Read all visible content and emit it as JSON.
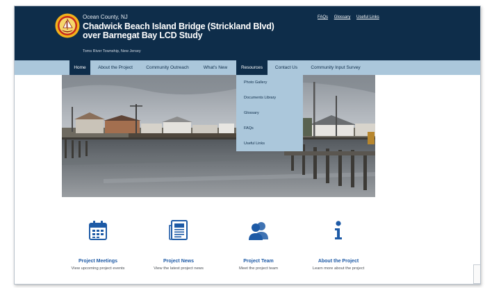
{
  "header": {
    "county": "Ocean County, NJ",
    "title": "Chadwick Beach Island Bridge (Strickland Blvd) over Barnegat Bay LCD Study",
    "subtitle": "Toms River Township, New Jersey",
    "utility_links": [
      "FAQs",
      "Glossary",
      "Useful Links"
    ]
  },
  "nav": {
    "items": [
      {
        "label": "Home"
      },
      {
        "label": "About the Project"
      },
      {
        "label": "Community Outreach"
      },
      {
        "label": "What's New"
      },
      {
        "label": "Resources"
      },
      {
        "label": "Contact Us"
      },
      {
        "label": "Community Input Survey"
      }
    ],
    "active": "Home",
    "open_menu": "Resources"
  },
  "resources_menu": {
    "items": [
      "Photo Gallery",
      "Documents Library",
      "Glossary",
      "FAQs",
      "Useful Links"
    ]
  },
  "cards": [
    {
      "title": "Project Meetings",
      "desc": "View upcoming project events",
      "icon": "calendar-icon"
    },
    {
      "title": "Project News",
      "desc": "View the latest project news",
      "icon": "newspaper-icon"
    },
    {
      "title": "Project Team",
      "desc": "Meet the project team",
      "icon": "team-icon"
    },
    {
      "title": "About the Project",
      "desc": "Learn more about the project",
      "icon": "info-icon"
    }
  ],
  "colors": {
    "header_bg": "#0e2d4a",
    "nav_bg": "#abc7db",
    "accent": "#1d5aa6"
  }
}
